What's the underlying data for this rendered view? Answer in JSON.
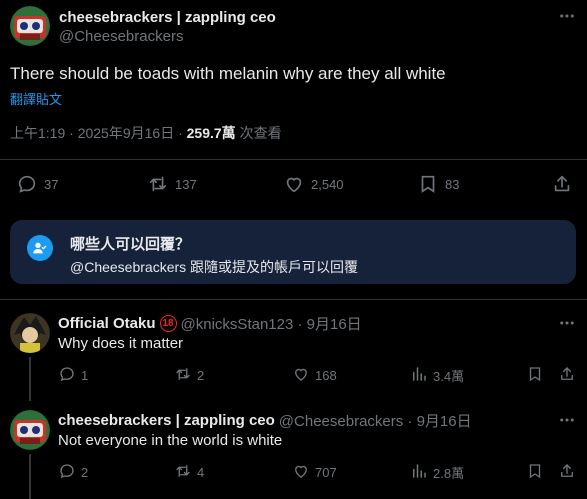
{
  "post": {
    "author_name": "cheesebrackers | zappling ceo",
    "author_handle": "@Cheesebrackers",
    "text": "There should be toads with melanin why are they all white",
    "translate_label": "翻譯貼文",
    "time": "上午1:19 · 2025年9月16日 · ",
    "views_count": "259.7萬",
    "views_label": " 次查看",
    "stats": {
      "replies": "37",
      "reposts": "137",
      "likes": "2,540",
      "bookmarks": "83"
    }
  },
  "who_can_reply": {
    "title": "哪些人可以回覆？",
    "subtitle": "@Cheesebrackers 跟隨或提及的帳戶可以回覆"
  },
  "replies": [
    {
      "name": "Official Otaku",
      "badge": "18",
      "meta": "@knicksStan123 · 9月16日",
      "text": "Why does it matter",
      "replies": "1",
      "reposts": "2",
      "likes": "168",
      "views": "3.4萬"
    },
    {
      "name": "cheesebrackers | zappling ceo",
      "meta": "@Cheesebrackers · 9月16日",
      "text": "Not everyone in the world is white",
      "replies": "2",
      "reposts": "4",
      "likes": "707",
      "views": "2.8萬"
    }
  ],
  "colors": {
    "accent": "#1d9bf0",
    "text": "#e7e9ea",
    "muted": "#71767b",
    "background": "#000000"
  },
  "icons": [
    "more-icon",
    "reply-icon",
    "repost-icon",
    "like-icon",
    "bookmark-icon",
    "share-icon",
    "views-icon",
    "person-check-icon"
  ]
}
